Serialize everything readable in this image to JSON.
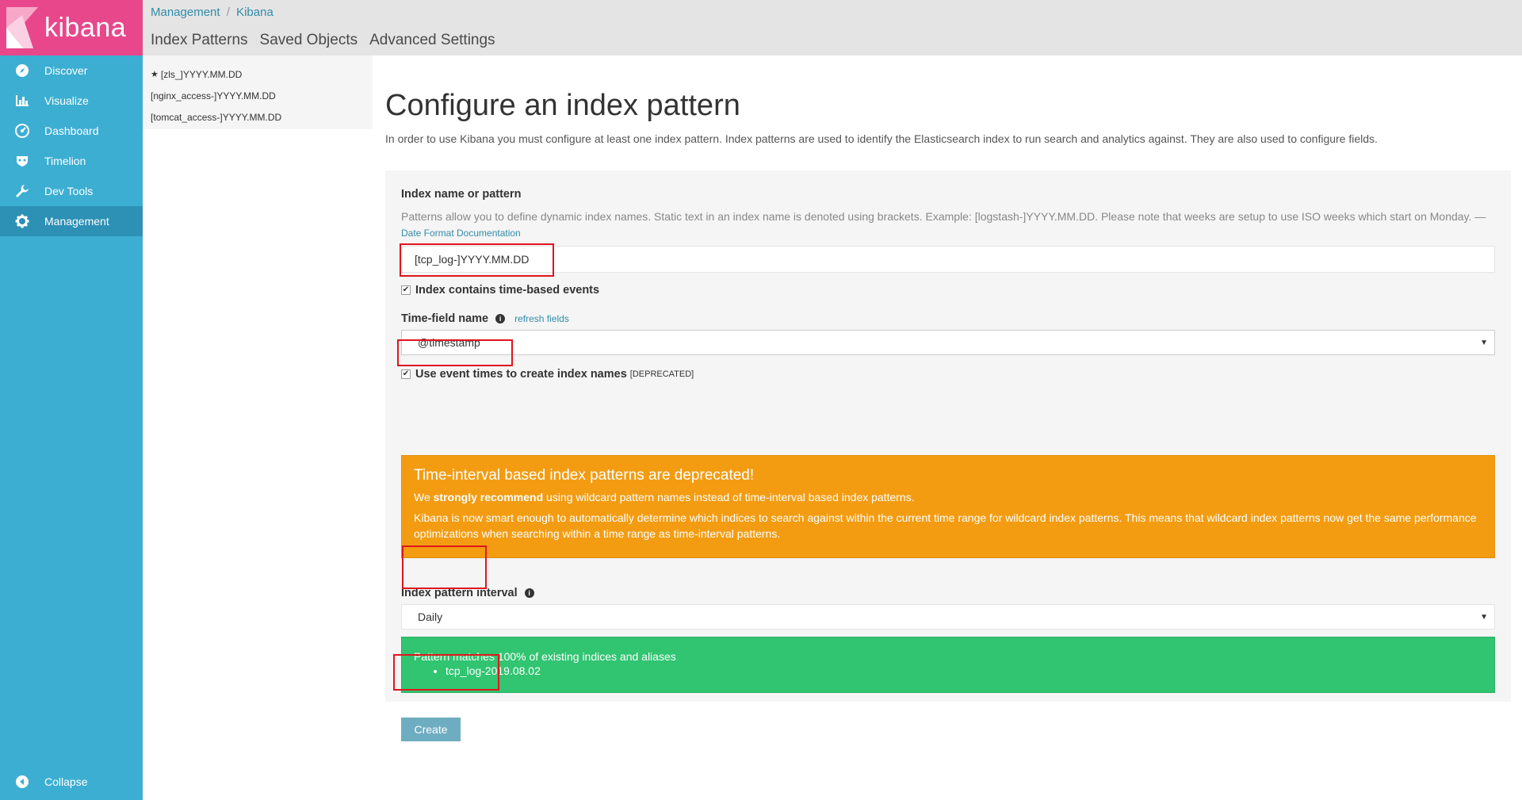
{
  "app": {
    "name": "kibana",
    "brand_color": "#e8488b",
    "sidebar_color": "#3caed2"
  },
  "sidebar": {
    "items": [
      {
        "label": "Discover",
        "icon": "compass-icon"
      },
      {
        "label": "Visualize",
        "icon": "bar-chart-icon"
      },
      {
        "label": "Dashboard",
        "icon": "gauge-icon"
      },
      {
        "label": "Timelion",
        "icon": "mask-icon"
      },
      {
        "label": "Dev Tools",
        "icon": "wrench-icon"
      },
      {
        "label": "Management",
        "icon": "gear-icon",
        "active": true
      }
    ],
    "collapse_label": "Collapse"
  },
  "breadcrumb": {
    "root": "Management",
    "separator": "/",
    "current": "Kibana"
  },
  "tabs": [
    "Index Patterns",
    "Saved Objects",
    "Advanced Settings"
  ],
  "index_patterns": [
    {
      "name": "[zls_]YYYY.MM.DD",
      "default": true
    },
    {
      "name": "[nginx_access-]YYYY.MM.DD",
      "default": false
    },
    {
      "name": "[tomcat_access-]YYYY.MM.DD",
      "default": false
    }
  ],
  "page": {
    "title": "Configure an index pattern",
    "intro": "In order to use Kibana you must configure at least one index pattern. Index patterns are used to identify the Elasticsearch index to run search and analytics against. They are also used to configure fields."
  },
  "form": {
    "index_label": "Index name or pattern",
    "index_help": "Patterns allow you to define dynamic index names. Static text in an index name is denoted using brackets. Example: [logstash-]YYYY.MM.DD. Please note that weeks are setup to use ISO weeks which start on Monday. —",
    "index_help_link": "Date Format Documentation",
    "index_value": "[tcp_log-]YYYY.MM.DD",
    "time_based_label": "Index contains time-based events",
    "time_based_checked": "✔",
    "time_field_label": "Time-field name",
    "refresh_fields": "refresh fields",
    "time_field_value": "@timestamp",
    "event_times_label": "Use event times to create index names",
    "event_times_tag": "[DEPRECATED]",
    "event_times_checked": "✔",
    "warning_title": "Time-interval based index patterns are deprecated!",
    "warning_p1_pre": "We",
    "warning_p1_strong": "strongly recommend",
    "warning_p1_post": "using wildcard pattern names instead of time-interval based index patterns.",
    "warning_p2": "Kibana is now smart enough to automatically determine which indices to search against within the current time range for wildcard index patterns. This means that wildcard index patterns now get the same performance optimizations when searching within a time range as time-interval patterns.",
    "interval_label": "Index pattern interval",
    "interval_value": "Daily",
    "success_text": "Pattern matches 100% of existing indices and aliases",
    "matched_index": "tcp_log-2019.08.02",
    "create_label": "Create"
  }
}
